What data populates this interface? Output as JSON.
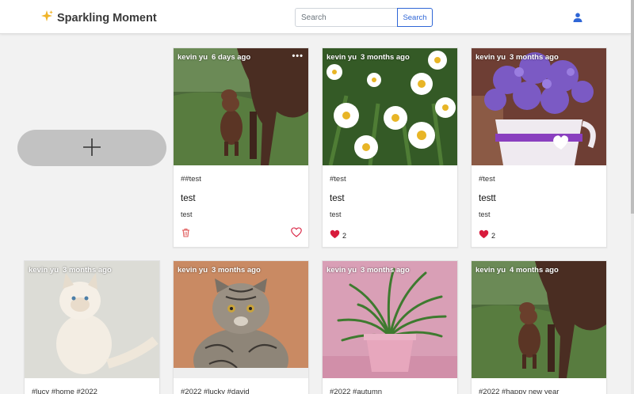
{
  "app": {
    "title": "Sparkling Moment"
  },
  "search": {
    "placeholder": "Search",
    "button_label": "Search"
  },
  "posts_row1": [
    {
      "author": "kevin yu",
      "time": "6 days ago",
      "tags": "##test",
      "title": "test",
      "desc": "test",
      "likes": ""
    },
    {
      "author": "kevin yu",
      "time": "3 months ago",
      "tags": "#test",
      "title": "test",
      "desc": "test",
      "likes": "2"
    },
    {
      "author": "kevin yu",
      "time": "3 months ago",
      "tags": "#test",
      "title": "testt",
      "desc": "test",
      "likes": "2"
    }
  ],
  "posts_row2": [
    {
      "author": "kevin yu",
      "time": "3 months ago",
      "tags": "#lucy #home #2022"
    },
    {
      "author": "kevin yu",
      "time": "3 months ago",
      "tags": "#2022 #lucky #david"
    },
    {
      "author": "kevin yu",
      "time": "3 months ago",
      "tags": "#2022 #autumn"
    },
    {
      "author": "kevin yu",
      "time": "4 months ago",
      "tags": "#2022 #happy new year"
    }
  ],
  "icons": {
    "logo": "sparkle-icon",
    "user": "user-icon",
    "add": "plus-icon",
    "more": "more-icon",
    "delete": "trash-icon",
    "like_outline": "heart-outline-icon",
    "like_filled": "heart-filled-icon"
  },
  "colors": {
    "accent": "#2f66d6",
    "heart": "#d81b3c",
    "add_button": "#c2c2c2"
  }
}
